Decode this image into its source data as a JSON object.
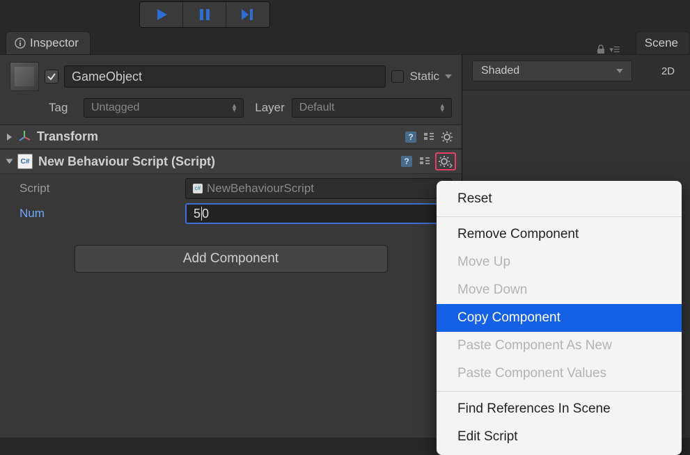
{
  "toolbar": {
    "play": "Play",
    "pause": "Pause",
    "step": "Step"
  },
  "tabs": {
    "inspector": "Inspector",
    "scene": "Scene"
  },
  "scene": {
    "shading": "Shaded",
    "mode2d": "2D"
  },
  "gameObject": {
    "enabled": true,
    "name": "GameObject",
    "static_label": "Static",
    "tag_label": "Tag",
    "tag_value": "Untagged",
    "layer_label": "Layer",
    "layer_value": "Default"
  },
  "components": [
    {
      "title": "Transform"
    },
    {
      "title": "New Behaviour Script (Script)",
      "script_label": "Script",
      "script_value": "NewBehaviourScript",
      "num_label": "Num",
      "num_value": "50"
    }
  ],
  "add_component": "Add Component",
  "context_menu": {
    "items": [
      {
        "label": "Reset",
        "enabled": true
      },
      {
        "sep": true
      },
      {
        "label": "Remove Component",
        "enabled": true
      },
      {
        "label": "Move Up",
        "enabled": false
      },
      {
        "label": "Move Down",
        "enabled": false
      },
      {
        "label": "Copy Component",
        "enabled": true,
        "selected": true
      },
      {
        "label": "Paste Component As New",
        "enabled": false
      },
      {
        "label": "Paste Component Values",
        "enabled": false
      },
      {
        "sep": true
      },
      {
        "label": "Find References In Scene",
        "enabled": true
      },
      {
        "label": "Edit Script",
        "enabled": true
      }
    ]
  },
  "colors": {
    "accent": "#3d6fd6",
    "highlight": "#e83e6b",
    "menu_select": "#1461e6"
  }
}
